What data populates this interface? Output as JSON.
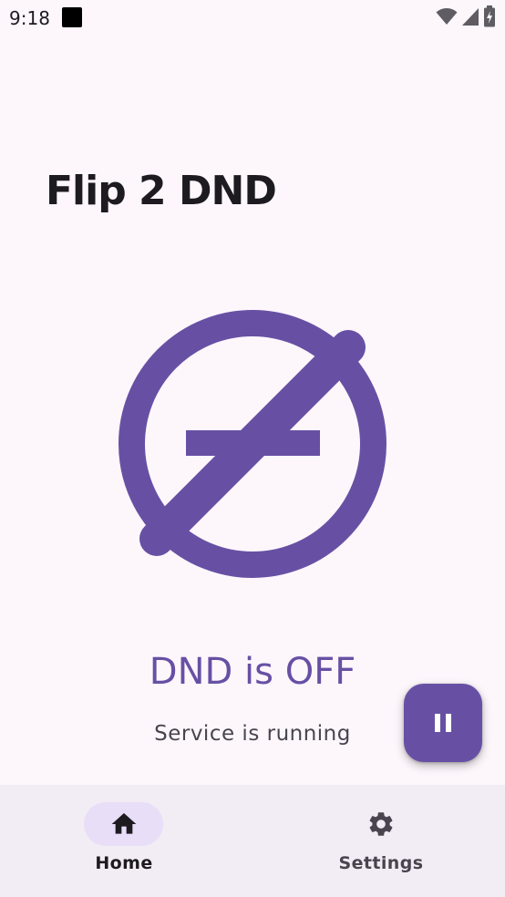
{
  "status_bar": {
    "time": "9:18",
    "icons": [
      "notification-square-icon",
      "wifi-icon",
      "cellular-signal-icon",
      "battery-charging-icon"
    ]
  },
  "app": {
    "title": "Flip 2 DND"
  },
  "main": {
    "logo_icon": "dnd-slash-icon",
    "dnd_status": "DND is OFF",
    "service_status": "Service is running"
  },
  "fab": {
    "icon": "pause-icon"
  },
  "bottom_nav": {
    "items": [
      {
        "label": "Home",
        "icon": "home-icon",
        "selected": true
      },
      {
        "label": "Settings",
        "icon": "settings-icon",
        "selected": false
      }
    ]
  },
  "colors": {
    "primary": "#6750a4",
    "background": "#fdf7fc",
    "nav_background": "#f2ecf4",
    "nav_indicator": "#e8def8",
    "on_surface": "#1d1b20"
  }
}
